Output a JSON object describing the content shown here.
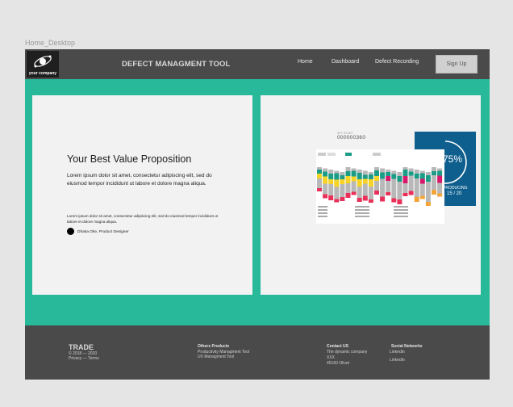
{
  "frame_label": "Home_Desktop",
  "header": {
    "logo_text": "your company",
    "app_title": "DEFECT MANAGMENT TOOL",
    "nav": [
      "Home",
      "Dashboard",
      "Defect Recording"
    ],
    "signup_label": "Sign Up"
  },
  "value_prop": {
    "title": "Your Best Value Proposition",
    "body": "Lorem ipsum dolor sit amet, consectetur adipiscing elit, sed do eiusmod tempor incididunt ut labore et dolore magna aliqua.",
    "small": "Lorem ipsum dolor sit amet, consectetur adipiscing elit, sed do eiusmod tempor incididunt ut labore et dolore magna aliqua.",
    "author": "Dhaka Oke, Product Designer"
  },
  "dashboard_preview": {
    "header_small": "SET STUDY",
    "number": "000000360",
    "percent": "75%",
    "producing_label": "PRODUCING",
    "count": "15 / 20",
    "colors": {
      "green": "#1a9c86",
      "yellow": "#f5d327",
      "gray": "#b8b8b8",
      "red": "#ea2f58",
      "pink": "#d8196b",
      "orange": "#f3a53a",
      "navy": "#0f5f8e"
    }
  },
  "footer": {
    "brand": "TRADE",
    "copyright": "© 2018 — 2020",
    "legal": "Privacy — Terms",
    "products_heading": "Others Products",
    "products": [
      "Productivity Managment Tool",
      "UX Managment Tool"
    ],
    "contact_heading": "Contact US",
    "contact_lines": [
      "The dynamic company",
      "XXX",
      "45160 Olivet"
    ],
    "social_heading": "Social Networks",
    "social_links": [
      "Linkedin",
      "Linkedin"
    ]
  }
}
